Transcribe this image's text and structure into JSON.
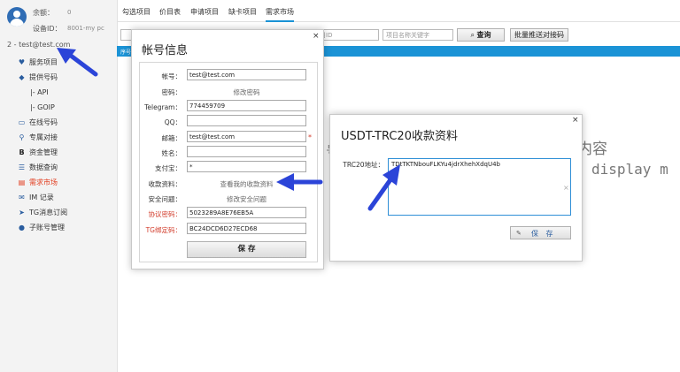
{
  "sidebar": {
    "balance_label": "余额：",
    "balance_value": "0",
    "device_label": "设备ID：",
    "device_value": "8001-my pc",
    "user_line": "2 - test@test.com",
    "items": [
      {
        "label": "服务项目",
        "icon": "heart-icon"
      },
      {
        "label": "提供号码",
        "icon": "diamond-icon"
      },
      {
        "label": "|- API",
        "icon": ""
      },
      {
        "label": "|- GOIP",
        "icon": ""
      },
      {
        "label": "在线号码",
        "icon": "monitor-icon"
      },
      {
        "label": "专属对接",
        "icon": "link-icon"
      },
      {
        "label": "资金管理",
        "icon": "bitcoin-icon"
      },
      {
        "label": "数据查询",
        "icon": "list-icon"
      },
      {
        "label": "需求市场",
        "icon": "document-icon"
      },
      {
        "label": "IM 记录",
        "icon": "envelope-icon"
      },
      {
        "label": "TG消息订阅",
        "icon": "telegram-icon"
      },
      {
        "label": "子账号管理",
        "icon": "users-icon"
      }
    ],
    "active_index": 8
  },
  "tabs": [
    "勾选项目",
    "价目表",
    "申请项目",
    "缺卡项目",
    "需求市场"
  ],
  "active_tab": 4,
  "toolbar": {
    "item_id_placeholder": "输入项目ID",
    "keyword_placeholder": "项目名称关键字",
    "search_label": "查询",
    "batch_label": "批量推送对接码"
  },
  "blue_bar_text": "序号",
  "background_text": {
    "cn": "内容",
    "en": "display m",
    "mid": "号"
  },
  "account_dialog": {
    "title": "帐号信息",
    "close": "×",
    "account_label": "帐号：",
    "account_value": "test@test.com",
    "password_label": "密码：",
    "password_link": "修改密码",
    "telegram_label": "Telegram：",
    "telegram_value": "774459709",
    "qq_label": "QQ：",
    "qq_value": "",
    "email_label": "邮箱：",
    "email_value": "test@test.com",
    "email_required": "*",
    "name_label": "姓名：",
    "name_value": "",
    "alipay_label": "支付宝：",
    "alipay_value": "*",
    "collection_label": "收款资料：",
    "collection_link": "查看我的收款资料",
    "security_label": "安全问题：",
    "security_link": "修改安全问题",
    "protocol_label": "协议密码：",
    "protocol_value": "5023289A8E76EB5A",
    "tg_key_label": "TG绑定码：",
    "tg_key_value": "BC24DCD6D27ECD68",
    "save_label": "保 存"
  },
  "usdt_dialog": {
    "title": "USDT-TRC20收款资料",
    "close": "×",
    "address_label": "TRC20地址：",
    "address_value": "TDtTKTNbouFLKYu4jdrXhehXdqU4b",
    "clear": "×",
    "save_label": "保 存"
  },
  "colors": {
    "accent": "#1b93d6",
    "arrow": "#2b44d8",
    "active_menu": "#e23b1d"
  }
}
